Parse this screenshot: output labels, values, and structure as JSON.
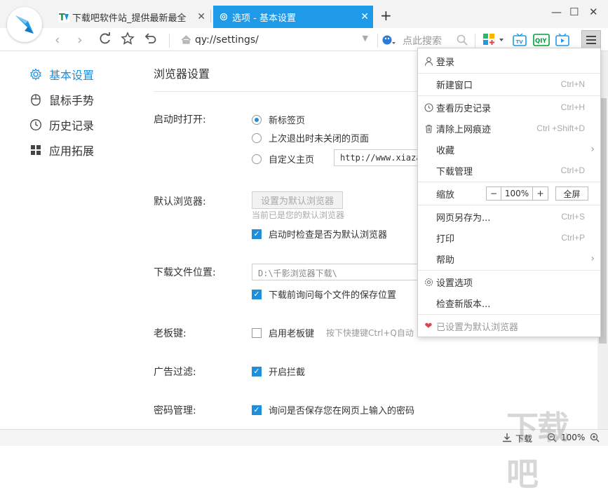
{
  "tabs": [
    {
      "title": "下载吧软件站_提供最新最全",
      "close": "✕"
    },
    {
      "title": "选项 - 基本设置",
      "close": "✕"
    }
  ],
  "new_tab": "+",
  "window": {
    "minimize": "—",
    "maximize": "☐",
    "close": "✕"
  },
  "toolbar": {
    "url": "qy://settings/",
    "search_placeholder": "点此搜索",
    "tv_label": "TV",
    "iqiyi_label": "QIY"
  },
  "sidebar": {
    "items": [
      {
        "label": "基本设置",
        "icon": "gear-icon",
        "active": true
      },
      {
        "label": "鼠标手势",
        "icon": "mouse-icon"
      },
      {
        "label": "历史记录",
        "icon": "clock-icon"
      },
      {
        "label": "应用拓展",
        "icon": "apps-grid-icon"
      }
    ]
  },
  "content": {
    "title": "浏览器设置",
    "startup": {
      "label": "启动时打开:",
      "options": [
        "新标签页",
        "上次退出时未关闭的页面",
        "自定义主页"
      ],
      "selected": 0,
      "homepage_value": "http://www.xiaza"
    },
    "default_browser": {
      "label": "默认浏览器:",
      "button": "设置为默认浏览器",
      "status": "当前已是您的默认浏览器",
      "check_label": "启动时检查是否为默认浏览器",
      "checked": true
    },
    "download": {
      "label": "下载文件位置:",
      "path": "D:\\千影浏览器下载\\",
      "check_label": "下载前询问每个文件的保存位置",
      "checked": true
    },
    "boss_key": {
      "label": "老板键:",
      "check_label": "启用老板键",
      "checked": false,
      "hint": "按下快捷键Ctrl+Q自动"
    },
    "ad_filter": {
      "label": "广告过滤:",
      "check_label": "开启拦截",
      "checked": true
    },
    "password": {
      "label": "密码管理:",
      "check_label": "询问是否保存您在网页上输入的密码",
      "checked": true
    }
  },
  "menu": {
    "login": "登录",
    "new_window": {
      "label": "新建窗口",
      "shortcut": "Ctrl+N"
    },
    "history": {
      "label": "查看历史记录",
      "shortcut": "Ctrl+H"
    },
    "clear": {
      "label": "清除上网痕迹",
      "shortcut": "Ctrl +Shift+D"
    },
    "favorites": {
      "label": "收藏"
    },
    "downloads": {
      "label": "下载管理",
      "shortcut": "Ctrl+D"
    },
    "zoom": {
      "label": "缩放",
      "minus": "−",
      "value": "100%",
      "plus": "+",
      "fullscreen": "全屏"
    },
    "save_as": {
      "label": "网页另存为...",
      "shortcut": "Ctrl+S"
    },
    "print": {
      "label": "打印",
      "shortcut": "Ctrl+P"
    },
    "help": {
      "label": "帮助"
    },
    "settings": {
      "label": "设置选项"
    },
    "update": {
      "label": "检查新版本..."
    },
    "default": {
      "label": "已设置为默认浏览器"
    }
  },
  "status": {
    "download": "下载",
    "zoom": "100%"
  },
  "watermark": "下载吧",
  "colors": {
    "accent": "#1f9ae8",
    "heart": "#e0434b"
  }
}
